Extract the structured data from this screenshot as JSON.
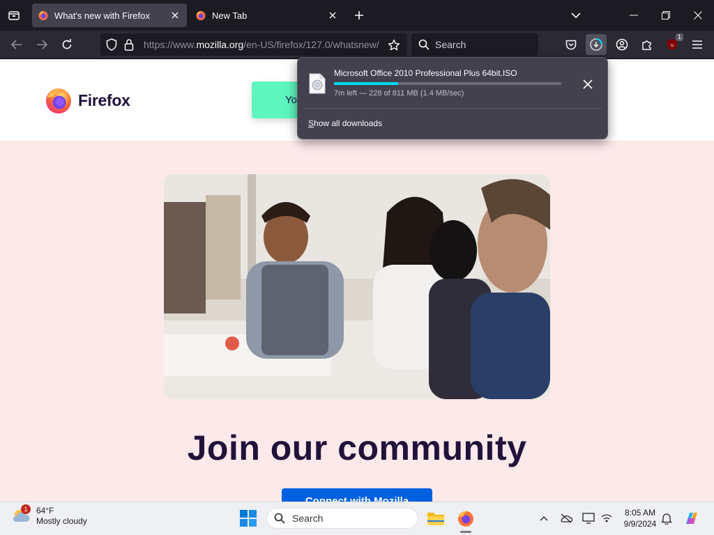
{
  "browser": {
    "tabs": [
      {
        "title": "What's new with Firefox",
        "active": true
      },
      {
        "title": "New Tab",
        "active": false
      }
    ],
    "url": {
      "scheme": "https://www.",
      "host": "mozilla.org",
      "path": "/en-US/firefox/127.0/whatsnew/"
    },
    "search_placeholder": "Search",
    "extension_badge": "1",
    "icons": [
      "tab-list-icon",
      "firefox-logo-icon",
      "close-icon",
      "plus-icon",
      "chevron-down-icon",
      "minimize-icon",
      "restore-icon",
      "back-arrow-icon",
      "forward-arrow-icon",
      "reload-icon",
      "shield-icon",
      "lock-icon",
      "star-icon",
      "search-icon",
      "pocket-icon",
      "downloads-icon",
      "account-icon",
      "extensions-icon",
      "ublock-icon",
      "hamburger-menu-icon"
    ]
  },
  "downloads_panel": {
    "filename": "Microsoft Office 2010 Professional Plus 64bit.ISO",
    "status": "7m left — 228 of 811 MB (1.4 MB/sec)",
    "progress": 0.281,
    "show_all_accesskey": "S",
    "show_all_rest": "how all downloads"
  },
  "page": {
    "logo_text": "Firefox",
    "promo_text": "Yo",
    "heading": "Join our community",
    "cta": "Connect with Mozilla"
  },
  "taskbar": {
    "weather_temp": "64°F",
    "weather_desc": "Mostly cloudy",
    "weather_badge": "1",
    "search_placeholder": "Search",
    "time": "8:05 AM",
    "date": "9/9/2024",
    "icons": [
      "weather-cloud-icon",
      "windows-start-icon",
      "search-icon",
      "file-explorer-icon",
      "firefox-icon",
      "chevron-up-icon",
      "onedrive-icon",
      "display-icon",
      "network-icon",
      "notification-bell-icon",
      "copilot-icon"
    ]
  },
  "colors": {
    "tabstrip": "#1c1b22",
    "toolbar": "#2b2a33",
    "page_bg": "#fde9ea",
    "promo_green": "#5ef5bf",
    "cta_blue": "#0060df",
    "heading": "#20123a",
    "progress": "#00ddff"
  }
}
